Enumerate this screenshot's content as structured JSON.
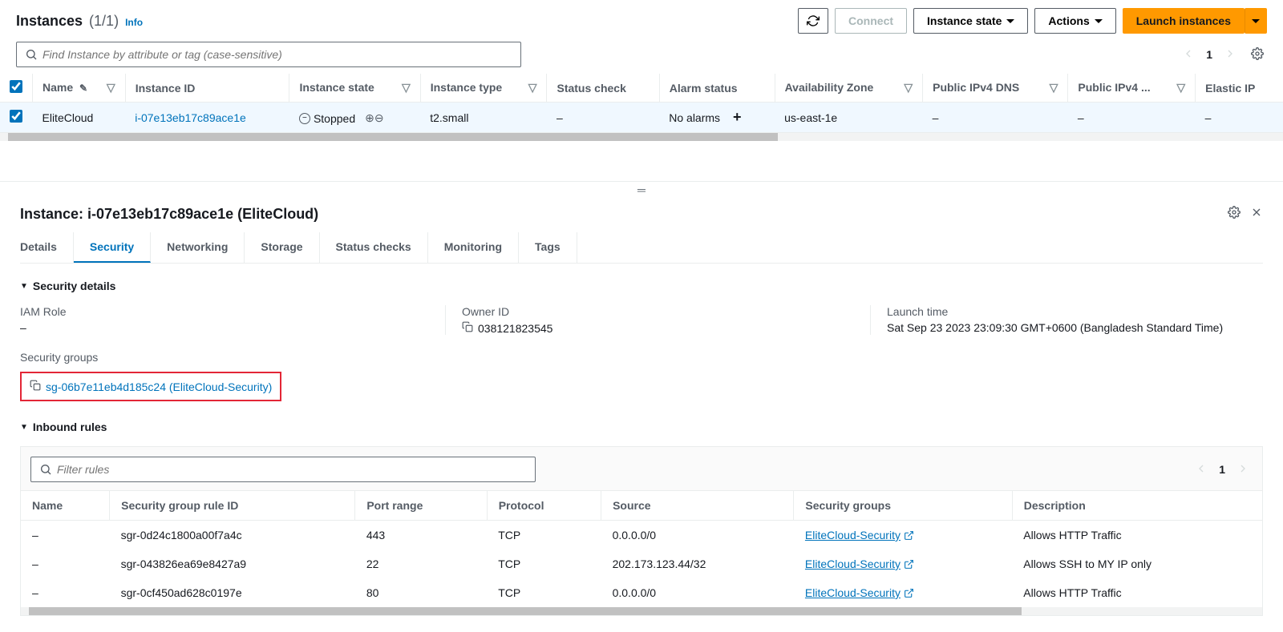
{
  "header": {
    "title": "Instances",
    "count": "(1/1)",
    "info": "Info",
    "refresh": "↻",
    "connect": "Connect",
    "instance_state": "Instance state",
    "actions": "Actions",
    "launch": "Launch instances"
  },
  "search": {
    "placeholder": "Find Instance by attribute or tag (case-sensitive)",
    "page": "1"
  },
  "columns": {
    "name": "Name",
    "instance_id": "Instance ID",
    "instance_state": "Instance state",
    "instance_type": "Instance type",
    "status_check": "Status check",
    "alarm_status": "Alarm status",
    "az": "Availability Zone",
    "dns": "Public IPv4 DNS",
    "ipv4": "Public IPv4 ...",
    "elastic_ip": "Elastic IP"
  },
  "row": {
    "name": "EliteCloud",
    "id": "i-07e13eb17c89ace1e",
    "state": "Stopped",
    "type": "t2.small",
    "status_check": "–",
    "alarm": "No alarms",
    "az": "us-east-1e",
    "dns": "–",
    "ipv4": "–",
    "eip": "–"
  },
  "detail": {
    "title": "Instance: i-07e13eb17c89ace1e (EliteCloud)",
    "tabs": {
      "details": "Details",
      "security": "Security",
      "networking": "Networking",
      "storage": "Storage",
      "status": "Status checks",
      "monitoring": "Monitoring",
      "tags": "Tags"
    },
    "security_details": "Security details",
    "iam_role_label": "IAM Role",
    "iam_role_value": "–",
    "owner_label": "Owner ID",
    "owner_value": "038121823545",
    "launch_label": "Launch time",
    "launch_value": "Sat Sep 23 2023 23:09:30 GMT+0600 (Bangladesh Standard Time)",
    "sg_label": "Security groups",
    "sg_value": "sg-06b7e11eb4d185c24 (EliteCloud-Security)",
    "inbound_rules": "Inbound rules",
    "filter_placeholder": "Filter rules",
    "rules_page": "1"
  },
  "rules_columns": {
    "name": "Name",
    "rule_id": "Security group rule ID",
    "port": "Port range",
    "protocol": "Protocol",
    "source": "Source",
    "sg": "Security groups",
    "desc": "Description"
  },
  "rules": [
    {
      "name": "–",
      "id": "sgr-0d24c1800a00f7a4c",
      "port": "443",
      "protocol": "TCP",
      "source": "0.0.0.0/0",
      "sg": "EliteCloud-Security",
      "desc": "Allows HTTP Traffic"
    },
    {
      "name": "–",
      "id": "sgr-043826ea69e8427a9",
      "port": "22",
      "protocol": "TCP",
      "source": "202.173.123.44/32",
      "sg": "EliteCloud-Security",
      "desc": "Allows SSH to MY IP only"
    },
    {
      "name": "–",
      "id": "sgr-0cf450ad628c0197e",
      "port": "80",
      "protocol": "TCP",
      "source": "0.0.0.0/0",
      "sg": "EliteCloud-Security",
      "desc": "Allows HTTP Traffic"
    }
  ]
}
